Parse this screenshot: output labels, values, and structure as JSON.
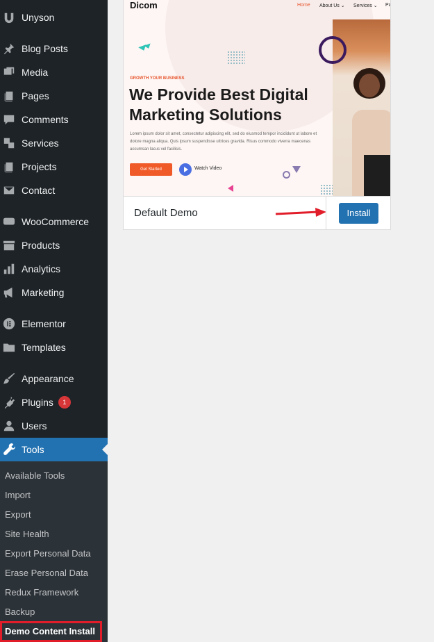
{
  "sidebar": {
    "items": [
      {
        "label": "Unyson",
        "icon": "unyson-icon"
      },
      {
        "label": "Blog Posts",
        "icon": "pin-icon"
      },
      {
        "label": "Media",
        "icon": "media-icon"
      },
      {
        "label": "Pages",
        "icon": "pages-icon"
      },
      {
        "label": "Comments",
        "icon": "comment-icon"
      },
      {
        "label": "Services",
        "icon": "services-icon"
      },
      {
        "label": "Projects",
        "icon": "projects-icon"
      },
      {
        "label": "Contact",
        "icon": "mail-icon"
      },
      {
        "label": "WooCommerce",
        "icon": "woo-icon"
      },
      {
        "label": "Products",
        "icon": "archive-icon"
      },
      {
        "label": "Analytics",
        "icon": "chart-bar-icon"
      },
      {
        "label": "Marketing",
        "icon": "megaphone-icon"
      },
      {
        "label": "Elementor",
        "icon": "elementor-icon"
      },
      {
        "label": "Templates",
        "icon": "folder-icon"
      },
      {
        "label": "Appearance",
        "icon": "brush-icon"
      },
      {
        "label": "Plugins",
        "icon": "plug-icon",
        "badge": "1"
      },
      {
        "label": "Users",
        "icon": "user-icon"
      },
      {
        "label": "Tools",
        "icon": "wrench-icon",
        "active": true
      }
    ],
    "tools_submenu": [
      "Available Tools",
      "Import",
      "Export",
      "Site Health",
      "Export Personal Data",
      "Erase Personal Data",
      "Redux Framework",
      "Backup",
      "Demo Content Install"
    ]
  },
  "demo": {
    "name": "Default Demo",
    "install_label": "Install",
    "preview": {
      "logo": "Dicom",
      "nav": [
        "Home",
        "About Us ⌄",
        "Services ⌄",
        "Pa"
      ],
      "eyebrow": "GROWTH YOUR BUSINESS",
      "headline": "We Provide Best Digital Marketing Solutions",
      "paragraph": "Lorem ipsum dolor sit amet, consectetur adipiscing elit, sed do eiusmod tempor incididunt ut labore et dolore magna aliqua. Quis ipsum suspendisse ultrices gravida. Risus commodo viverra maecenas accumsan lacus vel facilisis.",
      "cta_label": "Get Started",
      "video_label": "Watch Video"
    }
  },
  "colors": {
    "sidebar_bg": "#1d2327",
    "active_bg": "#2271b1",
    "badge": "#d63638",
    "highlight": "#e11d2a",
    "accent_orange": "#f05a28"
  }
}
